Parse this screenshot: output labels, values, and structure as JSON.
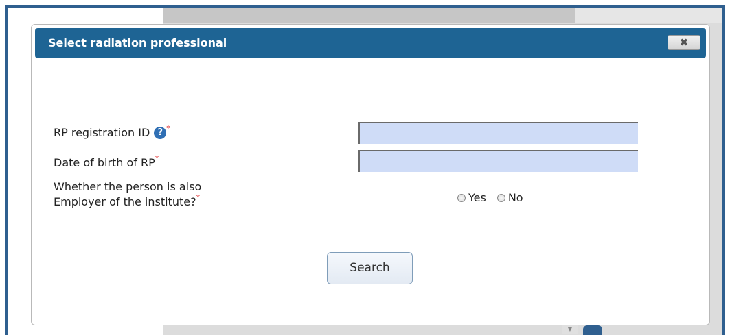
{
  "dialog": {
    "title": "Select radiation professional",
    "close_label": "✖"
  },
  "form": {
    "rp_id_label": "RP registration ID",
    "rp_id_value": "",
    "dob_label": "Date of birth of RP",
    "dob_value": "",
    "employer_label_line1": "Whether the person is also",
    "employer_label_line2": "Employer of the institute?",
    "required_marker": "*",
    "help_icon_glyph": "?",
    "options": [
      "Yes",
      "No"
    ],
    "selected": null
  },
  "actions": {
    "search_label": "Search"
  },
  "colors": {
    "titlebar": "#1e6494",
    "input_bg": "#cfdcf7",
    "required": "#e02020",
    "frame": "#2f5f8f"
  }
}
